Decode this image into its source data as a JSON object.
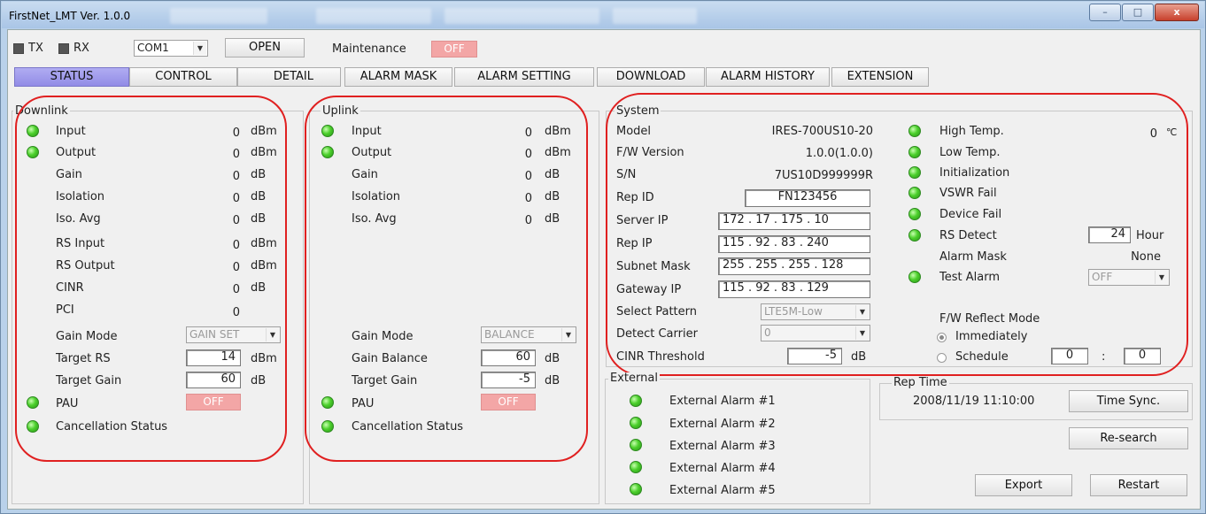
{
  "window": {
    "title": "FirstNet_LMT Ver. 1.0.0",
    "min": "–",
    "max": "□",
    "close": "x"
  },
  "toolbar": {
    "tx": "TX",
    "rx": "RX",
    "com": "COM1",
    "open": "OPEN",
    "maintenance": "Maintenance",
    "maint_state": "OFF"
  },
  "tabs": [
    "STATUS",
    "CONTROL",
    "DETAIL",
    "ALARM MASK",
    "ALARM SETTING",
    "DOWNLOAD",
    "ALARM HISTORY",
    "EXTENSION"
  ],
  "downlink": {
    "title": "Downlink",
    "rows": [
      {
        "label": "Input",
        "value": "0",
        "unit": "dBm"
      },
      {
        "label": "Output",
        "value": "0",
        "unit": "dBm"
      },
      {
        "label": "Gain",
        "value": "0",
        "unit": "dB"
      },
      {
        "label": "Isolation",
        "value": "0",
        "unit": "dB"
      },
      {
        "label": "Iso. Avg",
        "value": "0",
        "unit": "dB"
      },
      {
        "label": "RS Input",
        "value": "0",
        "unit": "dBm"
      },
      {
        "label": "RS Output",
        "value": "0",
        "unit": "dBm"
      },
      {
        "label": "CINR",
        "value": "0",
        "unit": "dB"
      },
      {
        "label": "PCI",
        "value": "0",
        "unit": ""
      }
    ],
    "gain_mode_label": "Gain Mode",
    "gain_mode": "GAIN SET",
    "target_rs_label": "Target RS",
    "target_rs": "14",
    "target_rs_unit": "dBm",
    "target_gain_label": "Target Gain",
    "target_gain": "60",
    "target_gain_unit": "dB",
    "pau_label": "PAU",
    "pau": "OFF",
    "cancel_label": "Cancellation Status"
  },
  "uplink": {
    "title": "Uplink",
    "rows": [
      {
        "label": "Input",
        "value": "0",
        "unit": "dBm"
      },
      {
        "label": "Output",
        "value": "0",
        "unit": "dBm"
      },
      {
        "label": "Gain",
        "value": "0",
        "unit": "dB"
      },
      {
        "label": "Isolation",
        "value": "0",
        "unit": "dB"
      },
      {
        "label": "Iso. Avg",
        "value": "0",
        "unit": "dB"
      }
    ],
    "gain_mode_label": "Gain Mode",
    "gain_mode": "BALANCE",
    "gain_balance_label": "Gain Balance",
    "gain_balance": "60",
    "gain_balance_unit": "dB",
    "target_gain_label": "Target Gain",
    "target_gain": "-5",
    "target_gain_unit": "dB",
    "pau_label": "PAU",
    "pau": "OFF",
    "cancel_label": "Cancellation Status"
  },
  "system": {
    "title": "System",
    "model_label": "Model",
    "model": "IRES-700US10-20",
    "fw_label": "F/W Version",
    "fw": "1.0.0(1.0.0)",
    "sn_label": "S/N",
    "sn": "7US10D999999R",
    "repid_label": "Rep ID",
    "repid": "FN123456",
    "server_label": "Server IP",
    "server": "172 . 17 . 175 . 10",
    "repip_label": "Rep IP",
    "repip": "115 . 92 . 83 . 240",
    "subnet_label": "Subnet Mask",
    "subnet": "255 . 255 . 255 . 128",
    "gateway_label": "Gateway IP",
    "gateway": "115 . 92 . 83 . 129",
    "pattern_label": "Select Pattern",
    "pattern": "LTE5M-Low",
    "carrier_label": "Detect Carrier",
    "carrier": "0",
    "cinr_label": "CINR Threshold",
    "cinr": "-5",
    "cinr_unit": "dB",
    "high_temp_label": "High Temp.",
    "high_temp": "0",
    "high_temp_unit": "℃",
    "low_temp_label": "Low Temp.",
    "init_label": "Initialization",
    "vswr_label": "VSWR Fail",
    "device_label": "Device Fail",
    "rs_label": "RS Detect",
    "rs_value": "24",
    "rs_unit": "Hour",
    "alarm_mask_label": "Alarm Mask",
    "alarm_mask": "None",
    "test_alarm_label": "Test Alarm",
    "test_alarm": "OFF",
    "fw_reflect_label": "F/W Reflect Mode",
    "immediately": "Immediately",
    "schedule": "Schedule",
    "sched_h": "0",
    "sched_colon": ":",
    "sched_m": "0"
  },
  "external": {
    "title": "External",
    "alarms": [
      "External Alarm #1",
      "External Alarm #2",
      "External Alarm #3",
      "External Alarm #4",
      "External Alarm #5"
    ]
  },
  "reptime": {
    "title": "Rep Time",
    "value": "2008/11/19 11:10:00",
    "sync": "Time Sync.",
    "research": "Re-search",
    "export": "Export",
    "restart": "Restart"
  }
}
